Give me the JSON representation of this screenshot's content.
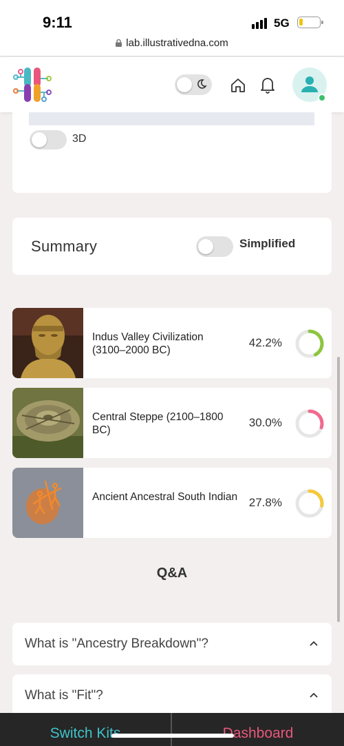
{
  "status_bar": {
    "time": "9:11",
    "network": "5G",
    "url": "lab.illustrativedna.com"
  },
  "header": {
    "icons": [
      "logo",
      "moon-icon",
      "home-icon",
      "bell-icon",
      "user-icon"
    ],
    "theme_toggle_on": false,
    "user_online": true
  },
  "map_card": {
    "toggle_3d_label": "3D",
    "toggle_3d_on": false
  },
  "summary": {
    "title": "Summary",
    "simplified_label": "Simplified",
    "simplified_on": false
  },
  "ancestry": [
    {
      "name": "Indus Valley Civilization (3100–2000 BC)",
      "percent_label": "42.2%",
      "percent": 42.2,
      "color": "#8cc63f",
      "image": "bronze-bust"
    },
    {
      "name": "Central Steppe (2100–1800 BC)",
      "percent_label": "30.0%",
      "percent": 30.0,
      "color": "#f06a8f",
      "image": "bronze-disc"
    },
    {
      "name": "Ancient Ancestral South Indian",
      "percent_label": "27.8%",
      "percent": 27.8,
      "color": "#f5c93a",
      "image": "rock-art"
    }
  ],
  "qa": {
    "title": "Q&A",
    "questions": [
      {
        "text": "What is \"Ancestry Breakdown\"?",
        "expanded": true
      },
      {
        "text": "What is \"Fit\"?",
        "expanded": true
      }
    ]
  },
  "bottom_nav": {
    "switch_kits": "Switch Kits",
    "dashboard": "Dashboard",
    "switch_color": "#3fc3c9",
    "dashboard_color": "#e9577d"
  }
}
